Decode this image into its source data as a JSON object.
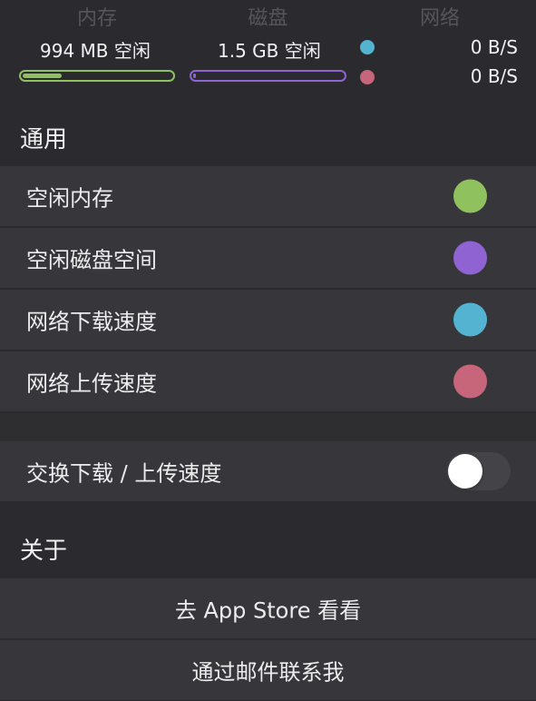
{
  "stats": {
    "memory": {
      "title": "内存",
      "value": "994 MB 空闲",
      "fill_fraction": 0.26
    },
    "disk": {
      "title": "磁盘",
      "value": "1.5 GB 空闲",
      "fill_fraction": 0.02
    },
    "network": {
      "title": "网络",
      "download": "0 B/S",
      "upload": "0 B/S"
    }
  },
  "general": {
    "header": "通用",
    "items": [
      {
        "label": "空闲内存",
        "color": "#8fc15f"
      },
      {
        "label": "空闲磁盘空间",
        "color": "#9063d2"
      },
      {
        "label": "网络下载速度",
        "color": "#55b3d2"
      },
      {
        "label": "网络上传速度",
        "color": "#c7667a"
      }
    ],
    "swap_label": "交换下载 / 上传速度",
    "swap_on": false
  },
  "about": {
    "header": "关于",
    "items": [
      {
        "label": "去 App Store 看看"
      },
      {
        "label": "通过邮件联系我"
      }
    ]
  },
  "colors": {
    "memory_bar": "#8fc15f",
    "disk_bar": "#9063d2",
    "download_dot": "#55b3d2",
    "upload_dot": "#c7667a"
  }
}
